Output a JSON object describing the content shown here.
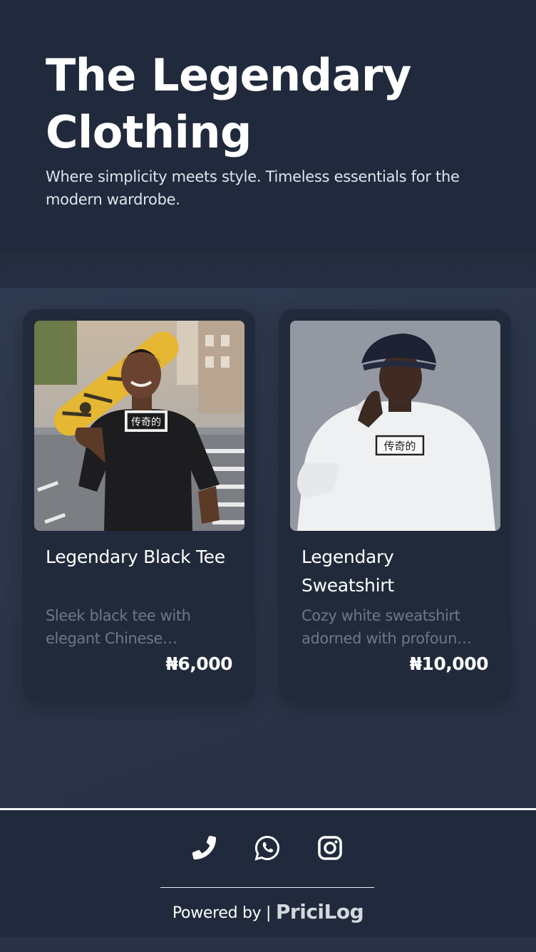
{
  "hero": {
    "title_line1": "The Legendary",
    "title_line2": "Clothing",
    "subtitle": "Where simplicity meets style. Timeless essentials for the modern wardrobe."
  },
  "products": [
    {
      "name": "Legendary Black Tee",
      "description": "Sleek black tee with elegant Chinese calligraphy print",
      "price": "₦6,000",
      "image": "model-skateboard-black-tee",
      "print_text": "传奇的"
    },
    {
      "name": "Legendary Sweatshirt",
      "description": "Cozy white sweatshirt adorned with profound Chinese calligraphy",
      "price": "₦10,000",
      "image": "model-bucket-hat-white-sweatshirt",
      "print_text": "传奇的"
    }
  ],
  "footer": {
    "icons": [
      "phone-icon",
      "whatsapp-icon",
      "instagram-icon"
    ],
    "powered_by": "Powered by |",
    "brand": "PriciLog"
  },
  "colors": {
    "background": "#2a3346",
    "hero": "#202a3c",
    "card": "#212a3b",
    "muted_text": "#6c778a"
  }
}
